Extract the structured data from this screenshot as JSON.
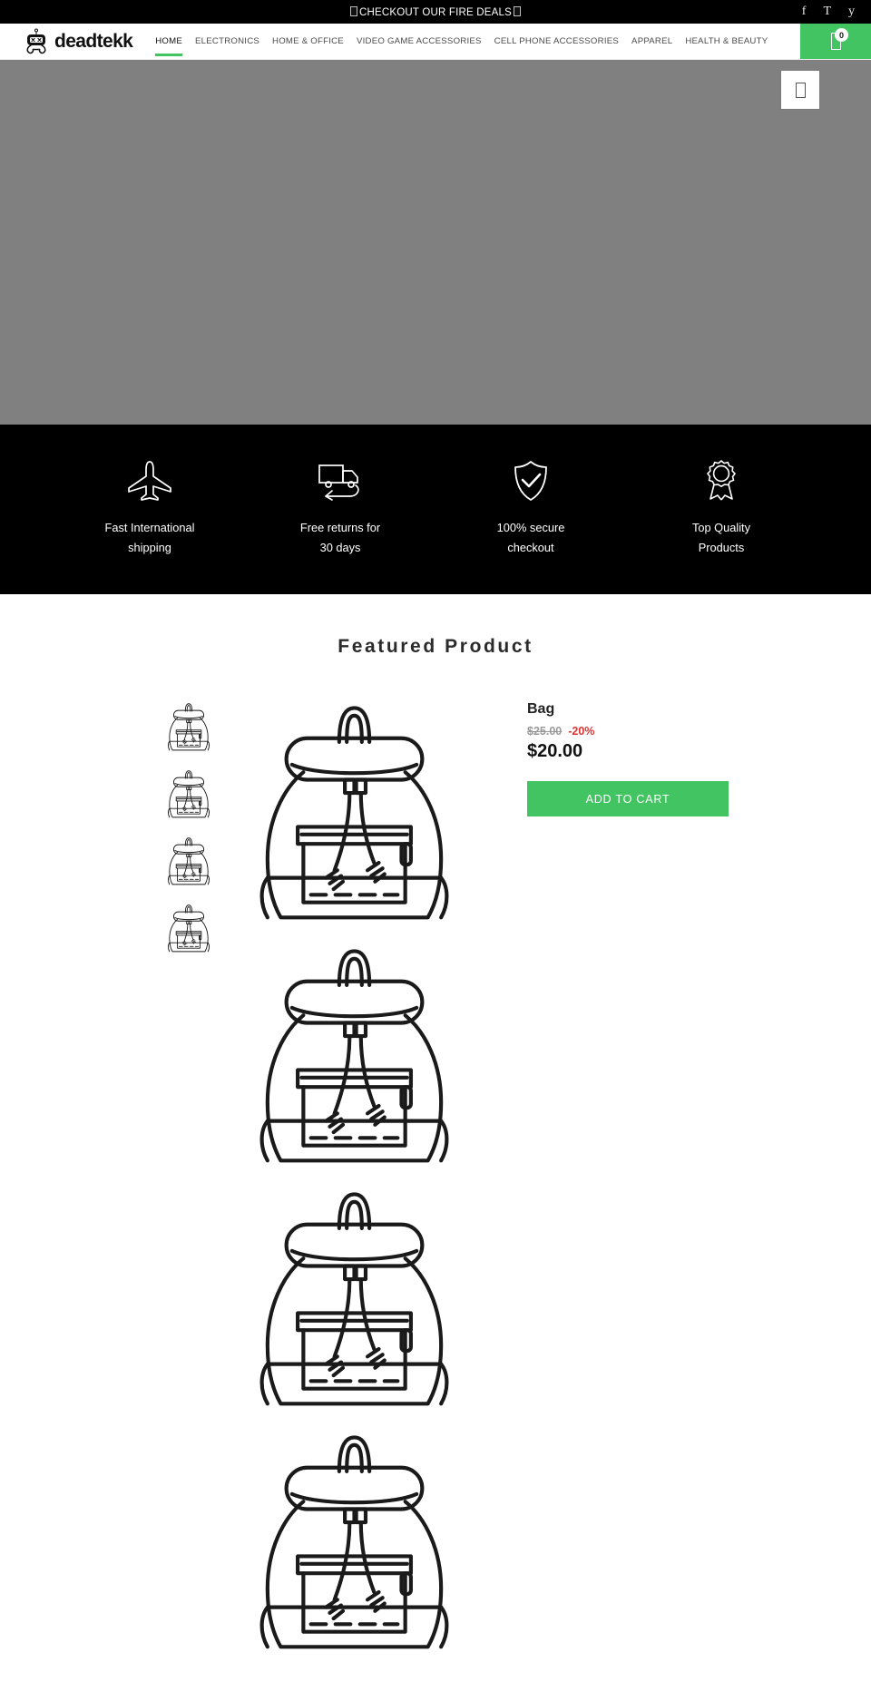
{
  "topbar": {
    "message_text": "CHECKOUT OUR FIRE DEALS",
    "social": [
      {
        "name": "facebook-icon",
        "glyph": "f"
      },
      {
        "name": "twitter-icon",
        "glyph": "T"
      },
      {
        "name": "youtube-icon",
        "glyph": "y"
      }
    ]
  },
  "header": {
    "brand_name": "deadtekk",
    "brand_icon": "robot-skull-logo",
    "nav": [
      {
        "label": "HOME",
        "active": true
      },
      {
        "label": "ELECTRONICS",
        "active": false
      },
      {
        "label": "HOME & OFFICE",
        "active": false
      },
      {
        "label": "VIDEO GAME ACCESSORIES",
        "active": false
      },
      {
        "label": "CELL PHONE ACCESSORIES",
        "active": false
      },
      {
        "label": "APPAREL",
        "active": false
      },
      {
        "label": "HEALTH & BEAUTY",
        "active": false
      }
    ],
    "cart": {
      "icon": "cart-icon",
      "count": "0"
    },
    "accent_color": "#43c462"
  },
  "hero": {
    "background_color": "#808080",
    "action_button_icon": "placeholder-glyph-icon"
  },
  "features": [
    {
      "icon": "airplane-icon",
      "line1": "Fast International",
      "line2": "shipping"
    },
    {
      "icon": "truck-return-icon",
      "line1": "Free returns for",
      "line2": "30 days"
    },
    {
      "icon": "shield-check-icon",
      "line1": "100% secure",
      "line2": "checkout"
    },
    {
      "icon": "award-ribbon-icon",
      "line1": "Top Quality",
      "line2": "Products"
    }
  ],
  "featured": {
    "section_title": "Featured Product",
    "product": {
      "title": "Bag",
      "compare_price": "$25.00",
      "discount": "-20%",
      "price": "$20.00",
      "add_to_cart_label": "ADD TO CART",
      "thumbnail_count": 4,
      "gallery_count": 4,
      "image_alt": "backpack-line-drawing"
    }
  }
}
